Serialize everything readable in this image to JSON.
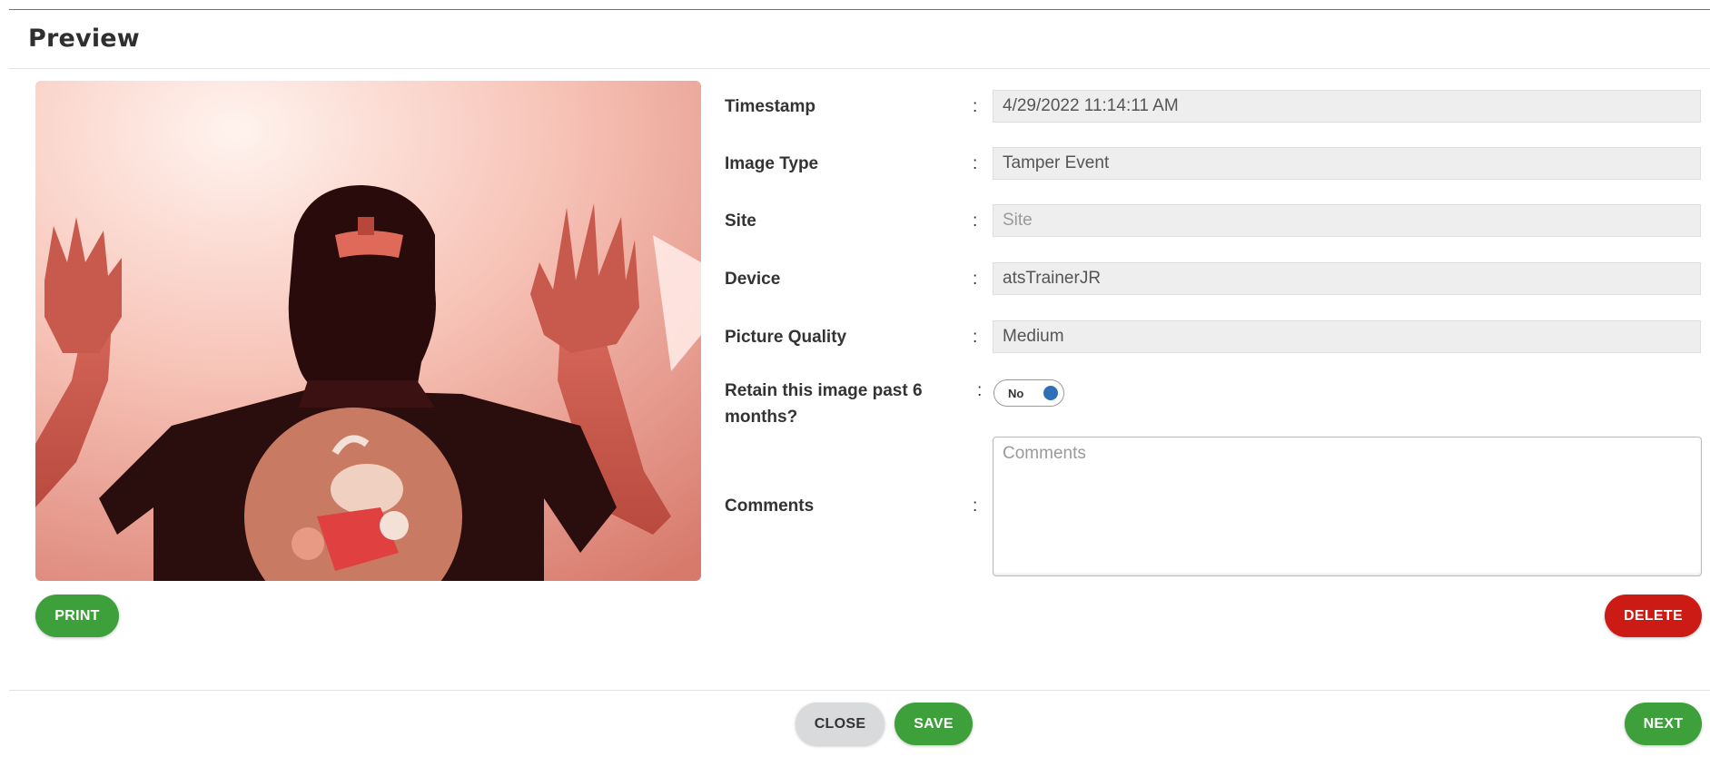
{
  "dialog": {
    "title": "Preview"
  },
  "image": {
    "alt": "Captured camera image of a person in a balaclava with raised hands"
  },
  "fields": {
    "timestamp": {
      "label": "Timestamp",
      "value": "4/29/2022 11:14:11 AM"
    },
    "image_type": {
      "label": "Image Type",
      "value": "Tamper Event"
    },
    "site": {
      "label": "Site",
      "value": "",
      "placeholder": "Site"
    },
    "device": {
      "label": "Device",
      "value": "atsTrainerJR"
    },
    "picture_quality": {
      "label": "Picture Quality",
      "value": "Medium"
    },
    "retain": {
      "label_line1": "Retain this image past 6",
      "label_line2": "months?",
      "toggle_label": "No"
    },
    "comments": {
      "label": "Comments",
      "placeholder": "Comments"
    }
  },
  "separator": ":",
  "buttons": {
    "print": "PRINT",
    "delete": "DELETE",
    "close": "CLOSE",
    "save": "SAVE",
    "next": "NEXT"
  },
  "colors": {
    "green": "#3da03a",
    "red": "#cc1b14",
    "gray": "#d9dadc",
    "toggle_knob": "#2e6fb7"
  },
  "icons": {
    "toggle": "toggle-switch-icon"
  }
}
